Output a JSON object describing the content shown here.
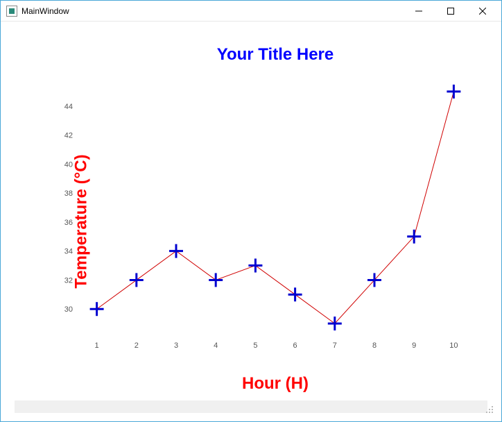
{
  "window": {
    "title": "MainWindow",
    "minimize_tooltip": "Minimize",
    "maximize_tooltip": "Maximize",
    "close_tooltip": "Close"
  },
  "chart_data": {
    "type": "line",
    "title": "Your Title Here",
    "xlabel": "Hour (H)",
    "ylabel": "Temperature (°C)",
    "x": [
      1,
      2,
      3,
      4,
      5,
      6,
      7,
      8,
      9,
      10
    ],
    "y": [
      30,
      32,
      34,
      32,
      33,
      31,
      29,
      32,
      35,
      45
    ],
    "xlim": [
      0.5,
      10.5
    ],
    "ylim": [
      28,
      46
    ],
    "xticks": [
      1,
      2,
      3,
      4,
      5,
      6,
      7,
      8,
      9,
      10
    ],
    "yticks": [
      30,
      32,
      34,
      36,
      38,
      40,
      42,
      44
    ],
    "marker": "plus",
    "line_color": "#d00000",
    "marker_color": "#0000d0",
    "title_color": "#0000ff",
    "label_color": "#ff0000"
  }
}
